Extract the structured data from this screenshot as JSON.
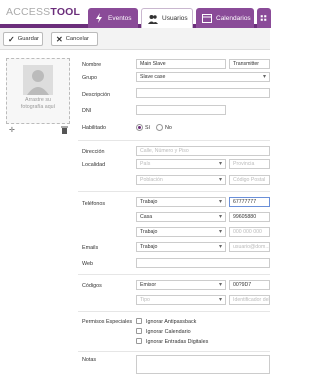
{
  "app": {
    "logo_left": "ACCESS",
    "logo_right": "TOOL"
  },
  "tabs": [
    {
      "label": "Eventos",
      "icon": "bolt-icon"
    },
    {
      "label": "Usuarios",
      "icon": "users-icon"
    },
    {
      "label": "Calendarios",
      "icon": "calendar-icon"
    }
  ],
  "toolbar": {
    "save_label": "Guardar",
    "cancel_label": "Cancelar"
  },
  "photo": {
    "placeholder_line1": "Arrastre su",
    "placeholder_line2": "fotografía aquí"
  },
  "form": {
    "nombre": {
      "label": "Nombre",
      "value": "Main Slave",
      "extra_value": "Transmitter"
    },
    "grupo": {
      "label": "Grupo",
      "value": "Slave case"
    },
    "descripcion": {
      "label": "Descripción"
    },
    "dni": {
      "label": "DNI"
    },
    "habilitado": {
      "label": "Habilitado",
      "yes": "Sí",
      "no": "No"
    },
    "direccion": {
      "label": "Dirección",
      "placeholder": "Calle, Número y Piso"
    },
    "localidad": {
      "label": "Localidad",
      "pais_placeholder": "País",
      "provincia_placeholder": "Provincia",
      "poblacion_placeholder": "Población",
      "cp_placeholder": "Código Postal"
    },
    "telefonos": {
      "label": "Teléfonos",
      "rows": [
        {
          "type": "Trabajo",
          "value": "67777777"
        },
        {
          "type": "Casa",
          "value": "99605880"
        },
        {
          "type": "Trabajo",
          "value": "000 000 000"
        }
      ]
    },
    "emails": {
      "label": "Emails",
      "type": "Trabajo",
      "placeholder": "usuario@dom..."
    },
    "web": {
      "label": "Web"
    },
    "codigos": {
      "label": "Códigos",
      "row1_type": "Emisor",
      "row1_value": "00?9D7",
      "row2_type": "Tipo",
      "row2_placeholder": "Identificador del..."
    },
    "permisos": {
      "label": "Permisos Especiales",
      "options": [
        "Ignorar Antipassback",
        "Ignorar Calendario",
        "Ignorar Entradas Digitales"
      ]
    },
    "notas": {
      "label": "Notas"
    }
  },
  "colors": {
    "brand": "#6b2e7b",
    "tab": "#8a4b98",
    "accent_blue": "#6a8fd8"
  }
}
